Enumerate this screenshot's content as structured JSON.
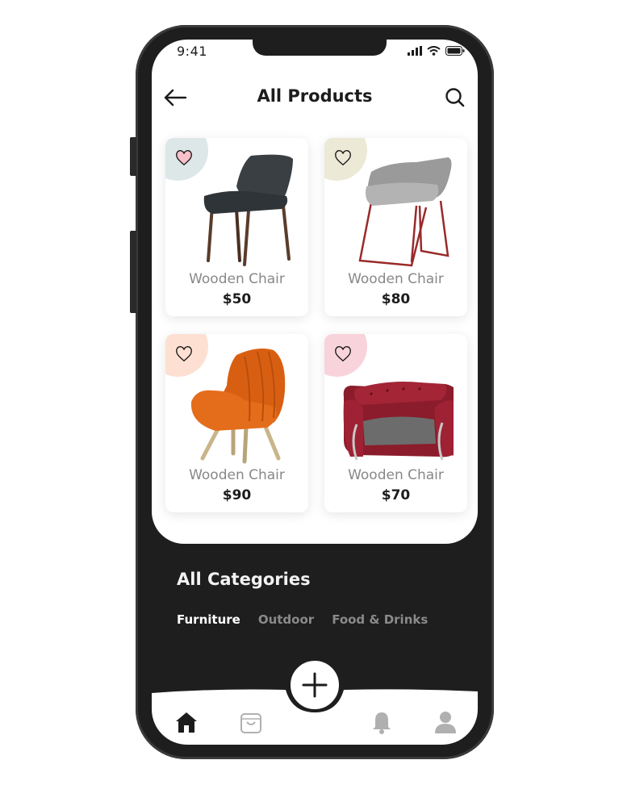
{
  "status_bar": {
    "time": "9:41"
  },
  "header": {
    "title": "All Products"
  },
  "products": [
    {
      "name": "Wooden Chair",
      "price": "$50",
      "fav_color": "#dde7e8",
      "favorited": true
    },
    {
      "name": "Wooden Chair",
      "price": "$80",
      "fav_color": "#ece9d6",
      "favorited": false
    },
    {
      "name": "Wooden Chair",
      "price": "$90",
      "fav_color": "#fde0d2",
      "favorited": false
    },
    {
      "name": "Wooden Chair",
      "price": "$70",
      "fav_color": "#f9d3dc",
      "favorited": false
    }
  ],
  "categories": {
    "title": "All Categories",
    "tabs": [
      "Furniture",
      "Outdoor",
      "Food & Drinks"
    ],
    "active": "Furniture"
  },
  "nav": {
    "items": [
      "home-icon",
      "bag-icon",
      "plus-icon",
      "bell-icon",
      "user-icon"
    ],
    "active": "home-icon"
  },
  "colors": {
    "dark": "#1e1e1e",
    "accent_fav": "#e8304a"
  }
}
